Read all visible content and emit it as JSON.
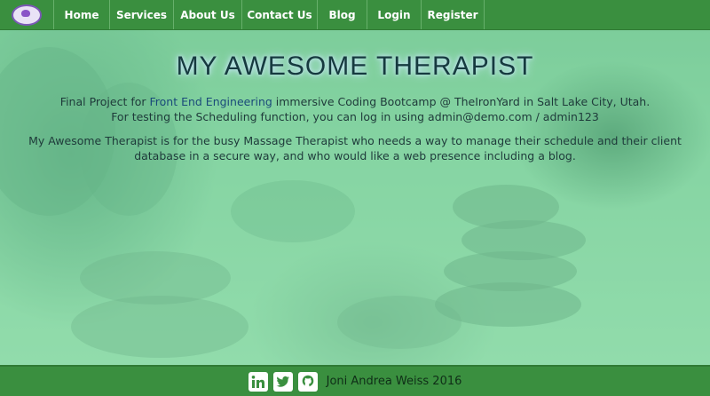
{
  "nav": {
    "logo_icon": "lotus-logo-icon",
    "items": [
      {
        "label": "Home"
      },
      {
        "label": "Services"
      },
      {
        "label": "About Us"
      },
      {
        "label": "Contact Us"
      },
      {
        "label": "Blog"
      },
      {
        "label": "Login"
      },
      {
        "label": "Register"
      }
    ]
  },
  "hero": {
    "title": "MY AWESOME THERAPIST",
    "intro_line1_prefix": "Final Project for ",
    "intro_line1_link": "Front End Engineering",
    "intro_line1_suffix": " immersive Coding Bootcamp @ TheIronYard in Salt Lake City, Utah.",
    "intro_line2": "For testing the Scheduling function, you can log in using admin@demo.com / admin123",
    "description": "My Awesome Therapist is for the busy Massage Therapist who needs a way to manage their schedule and their client database in a secure way, and who would like a web presence including a blog."
  },
  "footer": {
    "icons": [
      "linkedin-icon",
      "twitter-icon",
      "github-icon"
    ],
    "credit": "Joni Andrea Weiss 2016"
  },
  "colors": {
    "nav_green": "#3a8f3f",
    "accent_purple": "#8a55c7",
    "title_text": "#163a3f"
  }
}
